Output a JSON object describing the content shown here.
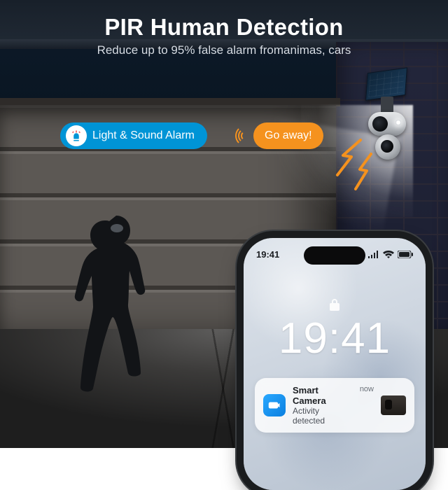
{
  "heading": {
    "title": "PIR Human Detection",
    "subtitle": "Reduce up to 95% false alarm fromanimas, cars"
  },
  "callouts": {
    "alarm_label": "Light & Sound Alarm",
    "shout_label": "Go away!"
  },
  "phone": {
    "status_time": "19:41",
    "lock_time": "19:41",
    "notification": {
      "app": "Smart Camera",
      "body": "Activity detected",
      "when": "now"
    }
  },
  "colors": {
    "blue": "#0094d6",
    "orange": "#f5921e"
  }
}
